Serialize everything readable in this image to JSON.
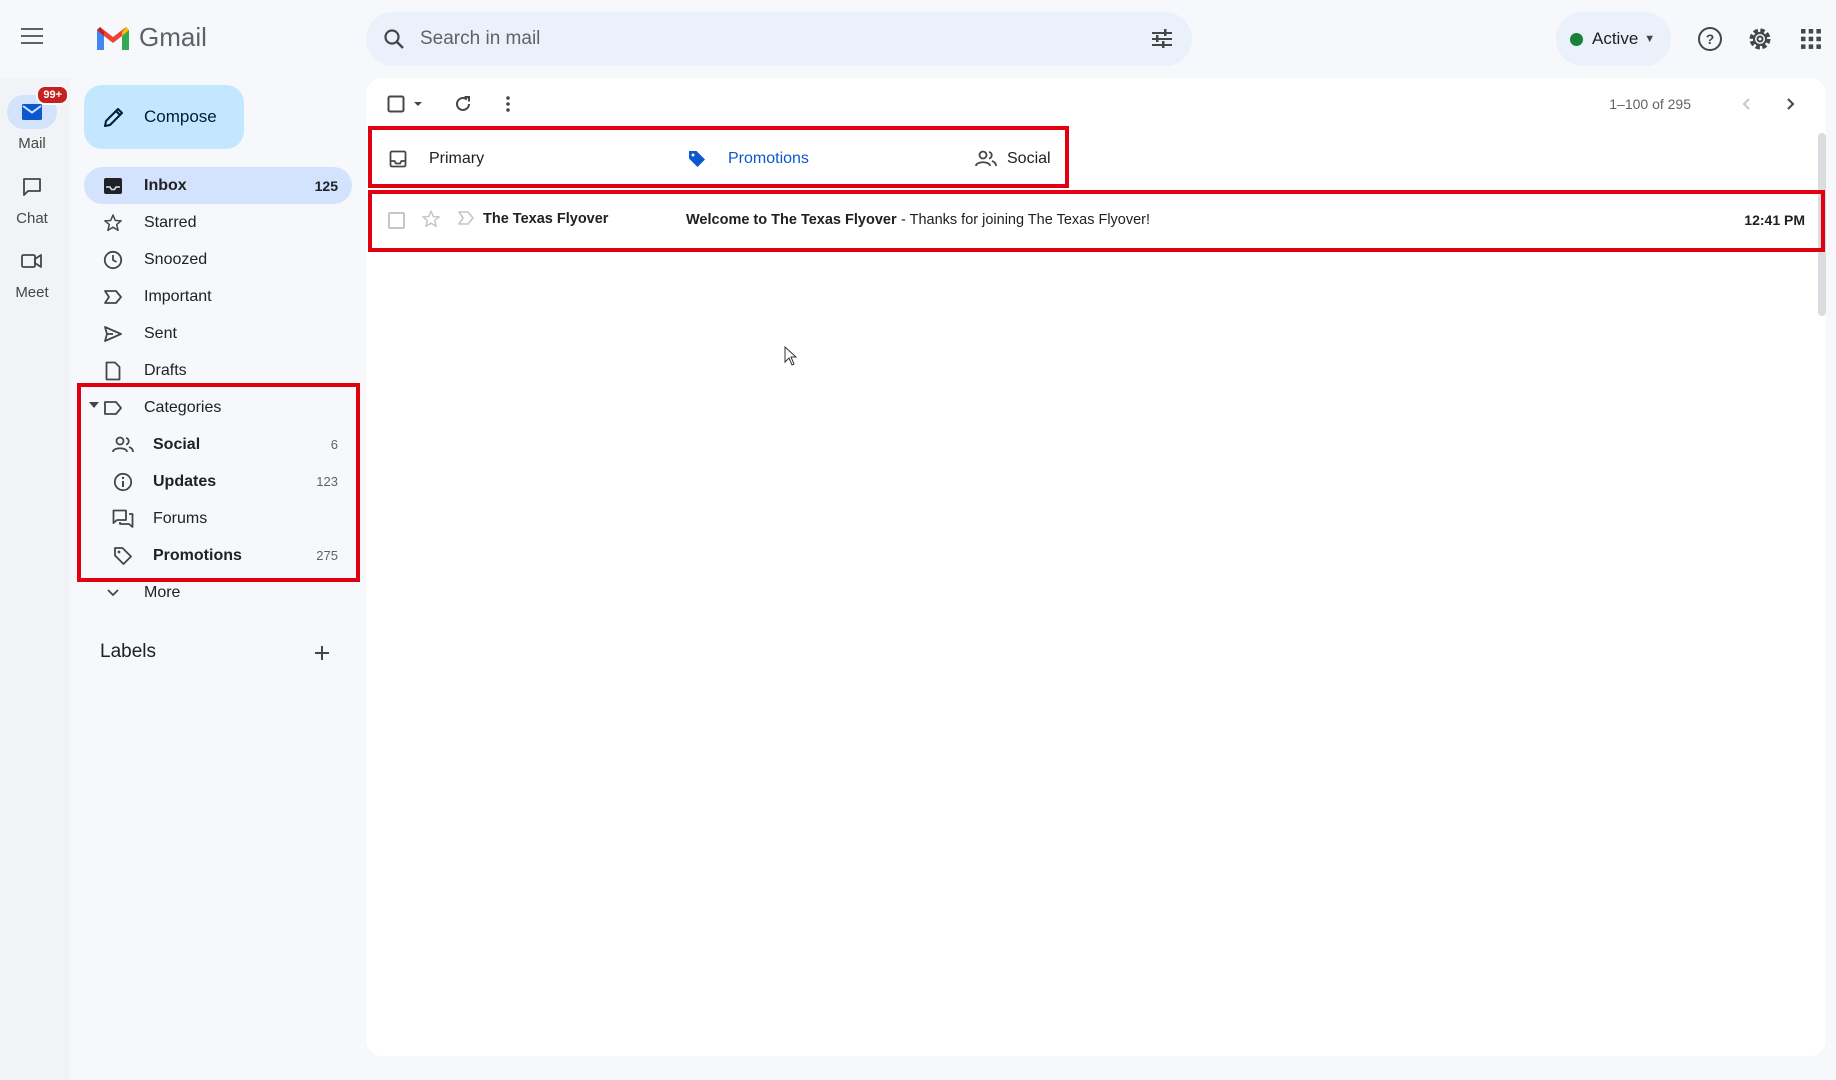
{
  "app": {
    "name": "Gmail"
  },
  "search": {
    "placeholder": "Search in mail"
  },
  "status": {
    "label": "Active",
    "color": "#188038"
  },
  "rail": {
    "items": [
      {
        "label": "Mail",
        "icon": "mail-icon",
        "badge": "99+"
      },
      {
        "label": "Chat",
        "icon": "chat-icon"
      },
      {
        "label": "Meet",
        "icon": "video-icon"
      }
    ]
  },
  "compose": {
    "label": "Compose"
  },
  "nav": {
    "items": [
      {
        "label": "Inbox",
        "count": "125",
        "icon": "inbox-icon"
      },
      {
        "label": "Starred",
        "icon": "star-icon"
      },
      {
        "label": "Snoozed",
        "icon": "clock-icon"
      },
      {
        "label": "Important",
        "icon": "important-icon"
      },
      {
        "label": "Sent",
        "icon": "send-icon"
      },
      {
        "label": "Drafts",
        "icon": "draft-icon"
      }
    ],
    "categories": {
      "label": "Categories",
      "items": [
        {
          "label": "Social",
          "count": "6",
          "icon": "people-icon"
        },
        {
          "label": "Updates",
          "count": "123",
          "icon": "info-icon"
        },
        {
          "label": "Forums",
          "icon": "forum-icon"
        },
        {
          "label": "Promotions",
          "count": "275",
          "icon": "tag-icon"
        }
      ]
    },
    "more": "More"
  },
  "labels": {
    "title": "Labels"
  },
  "toolbar": {
    "pager": "1–100 of 295"
  },
  "tabs": [
    {
      "label": "Primary",
      "icon": "inbox-icon"
    },
    {
      "label": "Promotions",
      "icon": "tag-icon"
    },
    {
      "label": "Social",
      "icon": "people-icon"
    }
  ],
  "emails": [
    {
      "sender": "The Texas Flyover",
      "subject": "Welcome to The Texas Flyover",
      "snippet": "- Thanks for joining The Texas Flyover!",
      "time": "12:41 PM"
    }
  ],
  "colors": {
    "accent": "#0b57d0",
    "highlight": "#e1000f",
    "selected_nav": "#d3e3fd",
    "compose": "#c2e7ff",
    "badge": "#c5221f"
  }
}
